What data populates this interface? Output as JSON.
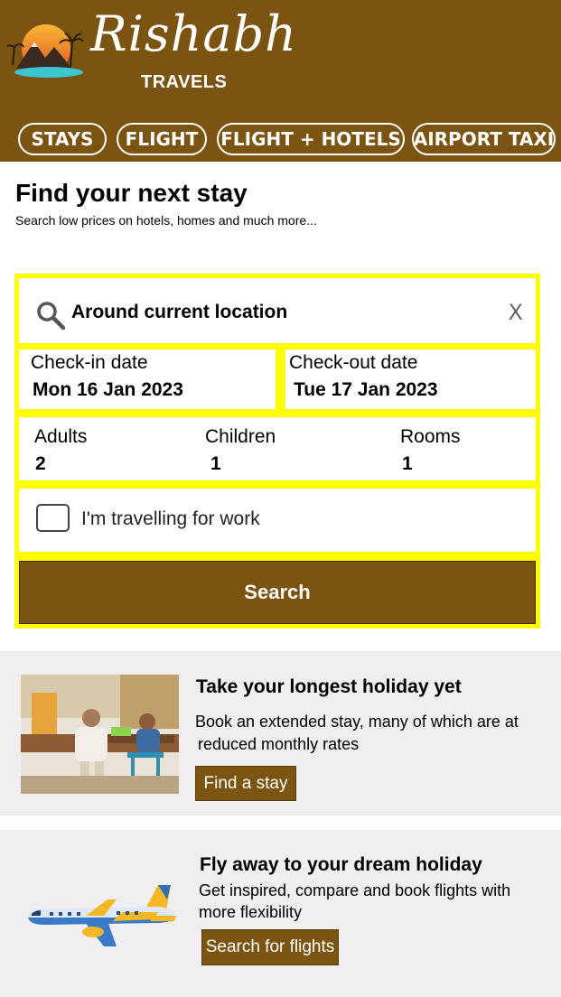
{
  "brand": {
    "name": "Rishabh",
    "sub": "TRAVELS"
  },
  "nav": [
    "STAYS",
    "FLIGHT",
    "FLIGHT + HOTELS",
    "AIRPORT TAXI"
  ],
  "heading": {
    "title": "Find your next stay",
    "subtitle": "Search low prices on hotels, homes and much more..."
  },
  "search": {
    "location": "Around current location",
    "clear": "X",
    "checkin": {
      "label": "Check-in date",
      "value": "Mon 16 Jan 2023"
    },
    "checkout": {
      "label": "Check-out date",
      "value": "Tue 17 Jan 2023"
    },
    "adults": {
      "label": "Adults",
      "value": "2"
    },
    "children": {
      "label": "Children",
      "value": "1"
    },
    "rooms": {
      "label": "Rooms",
      "value": "1"
    },
    "work_label": "I'm travelling for work",
    "button": "Search"
  },
  "promo_stay": {
    "title": "Take your longest holiday yet",
    "line1": "Book an extended stay, many of which are at",
    "line2": "reduced monthly rates",
    "button": "Find a stay"
  },
  "promo_flight": {
    "title": "Fly away to your dream holiday",
    "line1": "Get inspired, compare and book flights with",
    "line2": "more flexibility",
    "button": "Search for flights"
  },
  "colors": {
    "brand": "#7a5410",
    "highlight": "#ffff00",
    "card_bg": "#f0eef0"
  }
}
